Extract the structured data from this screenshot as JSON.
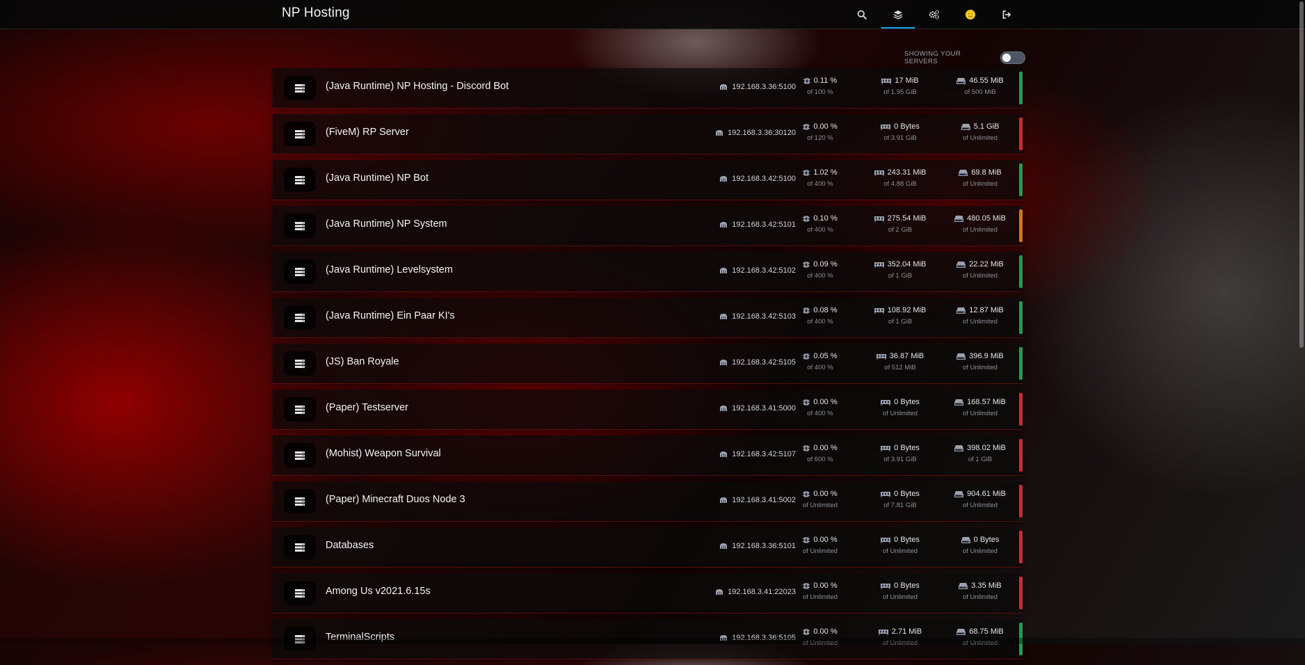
{
  "app": {
    "title": "NP Hosting"
  },
  "nav": [
    {
      "name": "search-icon"
    },
    {
      "name": "layers-icon",
      "active": true
    },
    {
      "name": "cogs-icon"
    },
    {
      "name": "avatar-icon"
    },
    {
      "name": "logout-icon"
    }
  ],
  "filter": {
    "label": "SHOWING YOUR SERVERS",
    "enabled": false
  },
  "colors": {
    "online": "#16a34a",
    "offline": "#dc2626",
    "starting": "#d97706",
    "accent": "#0ea5e9"
  },
  "servers": [
    {
      "name": "(Java Runtime) NP Hosting - Discord Bot",
      "address": "192.168.3.36:5100",
      "cpu": "0.11 %",
      "cpu_limit": "of 100 %",
      "memory": "17 MiB",
      "memory_limit": "of 1.95 GiB",
      "disk": "46.55 MiB",
      "disk_limit": "of 500 MiB",
      "status": "online"
    },
    {
      "name": "(FiveM) RP Server",
      "address": "192.168.3.36:30120",
      "cpu": "0.00 %",
      "cpu_limit": "of 120 %",
      "memory": "0 Bytes",
      "memory_limit": "of 3.91 GiB",
      "disk": "5.1 GiB",
      "disk_limit": "of Unlimited",
      "status": "offline"
    },
    {
      "name": "(Java Runtime) NP Bot",
      "address": "192.168.3.42:5100",
      "cpu": "1.02 %",
      "cpu_limit": "of 400 %",
      "memory": "243.31 MiB",
      "memory_limit": "of 4.88 GiB",
      "disk": "69.8 MiB",
      "disk_limit": "of Unlimited",
      "status": "online"
    },
    {
      "name": "(Java Runtime) NP System",
      "address": "192.168.3.42:5101",
      "cpu": "0.10 %",
      "cpu_limit": "of 400 %",
      "memory": "275.54 MiB",
      "memory_limit": "of 2 GiB",
      "disk": "480.05 MiB",
      "disk_limit": "of Unlimited",
      "status": "starting"
    },
    {
      "name": "(Java Runtime) Levelsystem",
      "address": "192.168.3.42:5102",
      "cpu": "0.09 %",
      "cpu_limit": "of 400 %",
      "memory": "352.04 MiB",
      "memory_limit": "of 1 GiB",
      "disk": "22.22 MiB",
      "disk_limit": "of Unlimited",
      "status": "online"
    },
    {
      "name": "(Java Runtime) Ein Paar KI's",
      "address": "192.168.3.42:5103",
      "cpu": "0.08 %",
      "cpu_limit": "of 400 %",
      "memory": "108.92 MiB",
      "memory_limit": "of 1 GiB",
      "disk": "12.87 MiB",
      "disk_limit": "of Unlimited",
      "status": "online"
    },
    {
      "name": "(JS) Ban Royale",
      "address": "192.168.3.42:5105",
      "cpu": "0.05 %",
      "cpu_limit": "of 400 %",
      "memory": "36.87 MiB",
      "memory_limit": "of 512 MiB",
      "disk": "396.9 MiB",
      "disk_limit": "of Unlimited",
      "status": "online"
    },
    {
      "name": "(Paper) Testserver",
      "address": "192.168.3.41:5000",
      "cpu": "0.00 %",
      "cpu_limit": "of 400 %",
      "memory": "0 Bytes",
      "memory_limit": "of Unlimited",
      "disk": "168.57 MiB",
      "disk_limit": "of Unlimited",
      "status": "offline"
    },
    {
      "name": "(Mohist) Weapon Survival",
      "address": "192.168.3.42:5107",
      "cpu": "0.00 %",
      "cpu_limit": "of 600 %",
      "memory": "0 Bytes",
      "memory_limit": "of 3.91 GiB",
      "disk": "398.02 MiB",
      "disk_limit": "of 1 GiB",
      "status": "offline"
    },
    {
      "name": "(Paper) Minecraft Duos Node 3",
      "address": "192.168.3.41:5002",
      "cpu": "0.00 %",
      "cpu_limit": "of Unlimited",
      "memory": "0 Bytes",
      "memory_limit": "of 7.81 GiB",
      "disk": "904.61 MiB",
      "disk_limit": "of Unlimited",
      "status": "offline"
    },
    {
      "name": "Databases",
      "address": "192.168.3.36:5101",
      "cpu": "0.00 %",
      "cpu_limit": "of Unlimited",
      "memory": "0 Bytes",
      "memory_limit": "of Unlimited",
      "disk": "0 Bytes",
      "disk_limit": "of Unlimited",
      "status": "offline"
    },
    {
      "name": "Among Us v2021.6.15s",
      "address": "192.168.3.41:22023",
      "cpu": "0.00 %",
      "cpu_limit": "of Unlimited",
      "memory": "0 Bytes",
      "memory_limit": "of Unlimited",
      "disk": "3.35 MiB",
      "disk_limit": "of Unlimited",
      "status": "offline"
    },
    {
      "name": "TerminalScripts",
      "address": "192.168.3.36:5105",
      "cpu": "0.00 %",
      "cpu_limit": "of Unlimited",
      "memory": "2.71 MiB",
      "memory_limit": "of Unlimited",
      "disk": "68.75 MiB",
      "disk_limit": "of Unlimited",
      "status": "online"
    }
  ]
}
